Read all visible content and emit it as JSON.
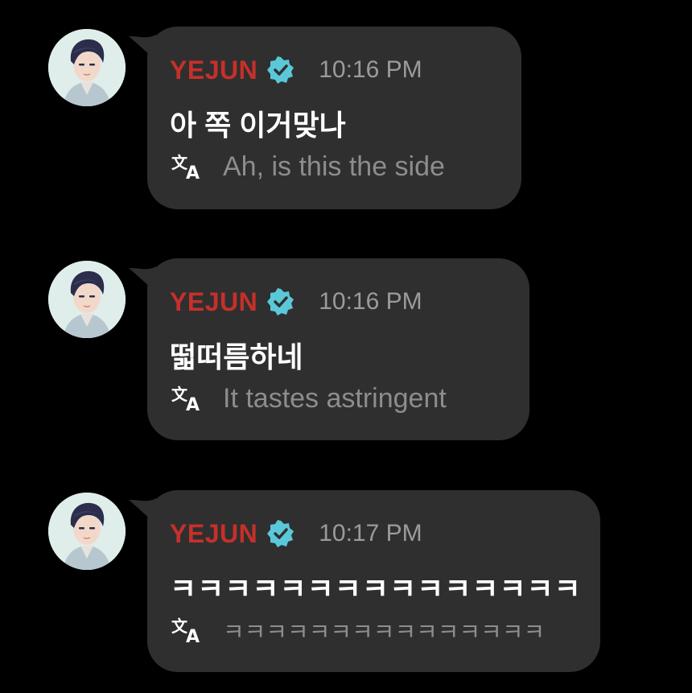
{
  "colors": {
    "background": "#000000",
    "bubble": "#2f2f2f",
    "username": "#c6302a",
    "verified_badge": "#5ac8d8",
    "timestamp": "#9b9b9b",
    "message_text": "#ffffff",
    "translation_text": "#8d8d8d"
  },
  "messages": [
    {
      "username": "YEJUN",
      "time": "10:16 PM",
      "text": "아 쪽 이거맞나",
      "translation": "Ah, is this the side",
      "verified_icon": "verified-badge-icon",
      "translate_icon": "translate-icon"
    },
    {
      "username": "YEJUN",
      "time": "10:16 PM",
      "text": "떫떠름하네",
      "translation": "It tastes astringent",
      "verified_icon": "verified-badge-icon",
      "translate_icon": "translate-icon"
    },
    {
      "username": "YEJUN",
      "time": "10:17 PM",
      "text": "ㅋㅋㅋㅋㅋㅋㅋㅋㅋㅋㅋㅋㅋㅋㅋ",
      "translation": "ㅋㅋㅋㅋㅋㅋㅋㅋㅋㅋㅋㅋㅋㅋㅋ",
      "verified_icon": "verified-badge-icon",
      "translate_icon": "translate-icon"
    }
  ]
}
